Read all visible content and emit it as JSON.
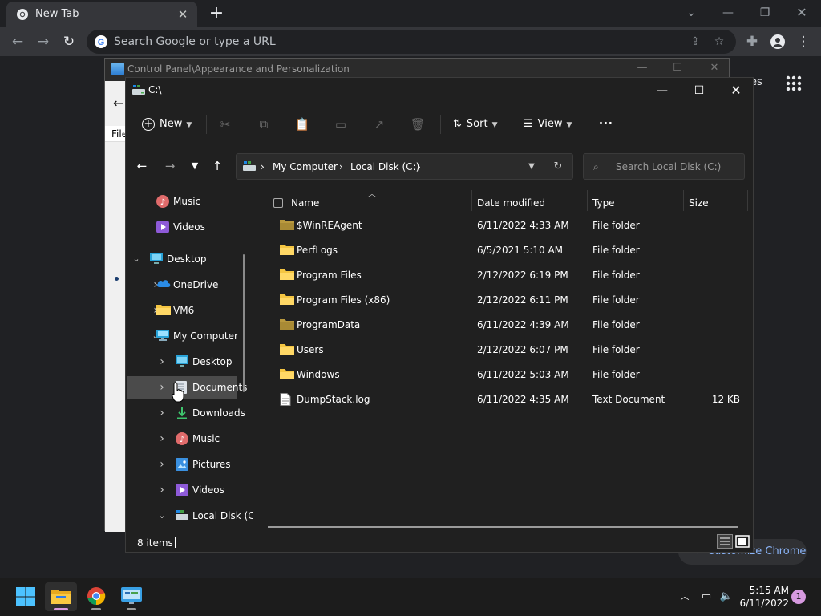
{
  "chrome": {
    "tab_title": "New Tab",
    "tab_close": "✕",
    "new_tab": "+",
    "omnibox_placeholder": "Search Google or type a URL",
    "ntp_links_label": "es",
    "customize_label": "Customize Chrome"
  },
  "control_panel": {
    "title": "Control Panel\\Appearance and Personalization",
    "menu_file": "File"
  },
  "explorer": {
    "title": "C:\\",
    "commands": {
      "new_label": "New",
      "sort_label": "Sort",
      "view_label": "View",
      "more_label": "···"
    },
    "breadcrumbs": [
      "My Computer",
      "Local Disk (C:)"
    ],
    "search_placeholder": "Search Local Disk (C:)",
    "sidebar": [
      {
        "label": "Music",
        "icon": "music-icon",
        "indent": 1,
        "chev": ""
      },
      {
        "label": "Videos",
        "icon": "videos-icon",
        "indent": 1,
        "chev": ""
      },
      {
        "label": "Desktop",
        "icon": "desktop-icon",
        "indent": 0,
        "chev": "expanded"
      },
      {
        "label": "OneDrive",
        "icon": "onedrive-icon",
        "indent": 1,
        "chev": "collapsed"
      },
      {
        "label": "VM6",
        "icon": "folder-icon",
        "indent": 1,
        "chev": "collapsed"
      },
      {
        "label": "My Computer",
        "icon": "computer-icon",
        "indent": 1,
        "chev": "expanded"
      },
      {
        "label": "Desktop",
        "icon": "desktop-icon",
        "indent": 2,
        "chev": "collapsed"
      },
      {
        "label": "Documents",
        "icon": "documents-icon",
        "indent": 2,
        "chev": "collapsed"
      },
      {
        "label": "Downloads",
        "icon": "downloads-icon",
        "indent": 2,
        "chev": "collapsed"
      },
      {
        "label": "Music",
        "icon": "music-icon",
        "indent": 2,
        "chev": "collapsed"
      },
      {
        "label": "Pictures",
        "icon": "pictures-icon",
        "indent": 2,
        "chev": "collapsed"
      },
      {
        "label": "Videos",
        "icon": "videos-icon",
        "indent": 2,
        "chev": "collapsed"
      },
      {
        "label": "Local Disk (C:",
        "icon": "drive-icon",
        "indent": 2,
        "chev": "expanded"
      }
    ],
    "columns": {
      "name": "Name",
      "date": "Date modified",
      "type": "Type",
      "size": "Size"
    },
    "files": [
      {
        "name": "$WinREAgent",
        "date": "6/11/2022 4:33 AM",
        "type": "File folder",
        "size": "",
        "icon": "folder-dim-icon"
      },
      {
        "name": "PerfLogs",
        "date": "6/5/2021 5:10 AM",
        "type": "File folder",
        "size": "",
        "icon": "folder-icon"
      },
      {
        "name": "Program Files",
        "date": "2/12/2022 6:19 PM",
        "type": "File folder",
        "size": "",
        "icon": "folder-icon"
      },
      {
        "name": "Program Files (x86)",
        "date": "2/12/2022 6:11 PM",
        "type": "File folder",
        "size": "",
        "icon": "folder-icon"
      },
      {
        "name": "ProgramData",
        "date": "6/11/2022 4:39 AM",
        "type": "File folder",
        "size": "",
        "icon": "folder-dim-icon"
      },
      {
        "name": "Users",
        "date": "2/12/2022 6:07 PM",
        "type": "File folder",
        "size": "",
        "icon": "folder-icon"
      },
      {
        "name": "Windows",
        "date": "6/11/2022 5:03 AM",
        "type": "File folder",
        "size": "",
        "icon": "folder-icon"
      },
      {
        "name": "DumpStack.log",
        "date": "6/11/2022 4:35 AM",
        "type": "Text Document",
        "size": "12 KB",
        "icon": "text-file-icon"
      }
    ],
    "status_count": "8 items"
  },
  "taskbar": {
    "time": "5:15 AM",
    "date": "6/11/2022",
    "notification_count": "1"
  },
  "colors": {
    "folder": "#f4c542",
    "folder_dim": "#b9993e",
    "accent": "#d79ae0",
    "link": "#8ab4f8"
  }
}
